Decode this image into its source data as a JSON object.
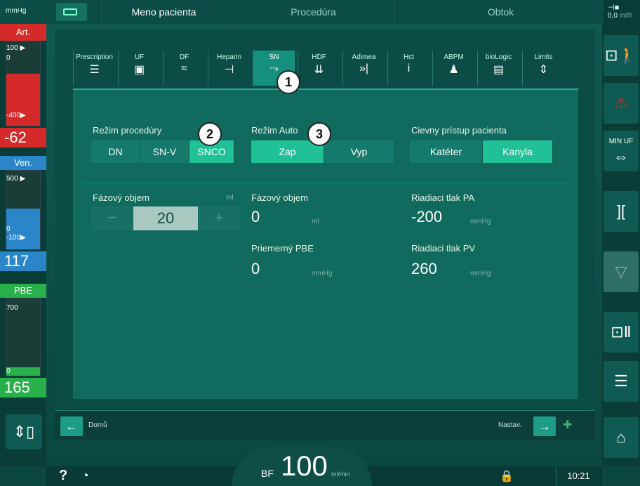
{
  "topbar": {
    "unit": "mmHg",
    "tabs": [
      "Meno pacienta",
      "Procedúra",
      "Obtok"
    ],
    "right_value": "0,0",
    "right_unit": "ml/h"
  },
  "left": {
    "art": {
      "title": "Art.",
      "ticks": [
        "100 ▶",
        "0",
        "-400▶"
      ],
      "value": "-62"
    },
    "ven": {
      "title": "Ven.",
      "ticks": [
        "500 ▶",
        "0",
        "-100▶"
      ],
      "value": "117"
    },
    "pbe": {
      "title": "PBE",
      "ticks": [
        "700",
        "0"
      ],
      "value": "165"
    }
  },
  "subtabs": [
    {
      "label": "Prescription",
      "icon": "sliders-icon",
      "glyph": "☰"
    },
    {
      "label": "UF",
      "icon": "uf-icon",
      "glyph": "▣"
    },
    {
      "label": "DF",
      "icon": "df-icon",
      "glyph": "≈"
    },
    {
      "label": "Heparin",
      "icon": "heparin-icon",
      "glyph": "⊣"
    },
    {
      "label": "SN",
      "icon": "sn-icon",
      "glyph": "⤳"
    },
    {
      "label": "HDF",
      "icon": "hdf-icon",
      "glyph": "⇊"
    },
    {
      "label": "Adimea",
      "icon": "adimea-icon",
      "glyph": "»|"
    },
    {
      "label": "Hct",
      "icon": "hct-icon",
      "glyph": "i"
    },
    {
      "label": "ABPM",
      "icon": "abpm-icon",
      "glyph": "♟"
    },
    {
      "label": "bioLogic",
      "icon": "biologic-icon",
      "glyph": "▤"
    },
    {
      "label": "Limits",
      "icon": "limits-icon",
      "glyph": "⇕"
    }
  ],
  "mode": {
    "label": "Režim procedúry",
    "options": [
      "DN",
      "SN-V",
      "SNCO"
    ],
    "selected": "SNCO"
  },
  "auto": {
    "label": "Režim Auto",
    "options": [
      "Zap",
      "Vyp"
    ],
    "selected": "Zap"
  },
  "access": {
    "label": "Cievny prístup pacienta",
    "options": [
      "Katéter",
      "Kanyla"
    ],
    "selected": "Kanyla"
  },
  "phase_volume_set": {
    "label": "Fázový objem",
    "unit": "ml",
    "value": "20",
    "minus": "−",
    "plus": "+"
  },
  "phase_volume": {
    "label": "Fázový objem",
    "value": "0",
    "unit": "ml"
  },
  "avg_pbe": {
    "label": "Priemerný PBE",
    "value": "0",
    "unit": "mmHg"
  },
  "pa": {
    "label": "Riadiaci tlak PA",
    "value": "-200",
    "unit": "mmHg"
  },
  "pv": {
    "label": "Riadiaci tlak PV",
    "value": "260",
    "unit": "mmHg"
  },
  "badges": [
    "1",
    "2",
    "3"
  ],
  "footer": {
    "home": "Domů",
    "settings": "Nastav."
  },
  "bottom": {
    "bf_label": "BF",
    "bf_value": "100",
    "bf_unit": "ml/min",
    "time": "10:21",
    "help": "?"
  },
  "right_buttons": [
    "MIN UF"
  ]
}
